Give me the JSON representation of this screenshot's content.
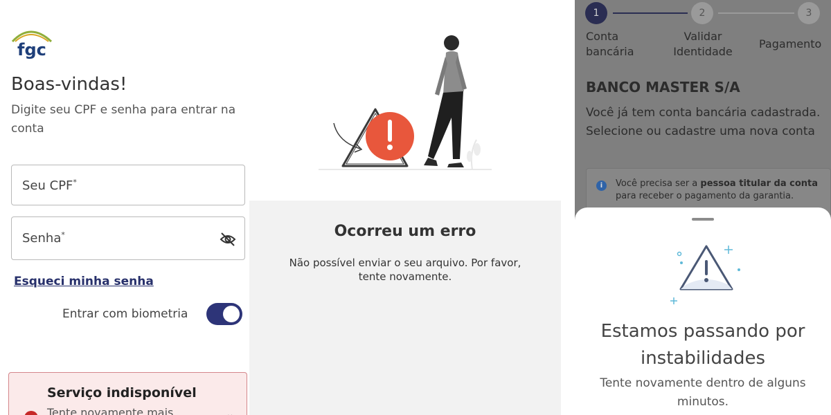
{
  "login": {
    "logo_text": "fgc",
    "welcome": "Boas-vindas!",
    "subtitle": "Digite seu CPF e senha para entrar na conta",
    "cpf_placeholder": "Seu CPF",
    "password_placeholder": "Senha",
    "required_mark": "*",
    "forgot_link": "Esqueci minha senha",
    "biometric_label": "Entrar com biometria",
    "biometric_enabled": true,
    "alert": {
      "title": "Serviço indisponível",
      "message": "Tente novamente mais"
    }
  },
  "error_screen": {
    "title": "Ocorreu um erro",
    "message": "Não possível enviar o seu arquivo. Por favor, tente novamente."
  },
  "payment_flow": {
    "steps": [
      {
        "number": "1",
        "label": "Conta bancária",
        "active": true
      },
      {
        "number": "2",
        "label": "Validar Identidade",
        "active": false
      },
      {
        "number": "3",
        "label": "Pagamento",
        "active": false
      }
    ],
    "bank_name": "BANCO MASTER S/A",
    "description": "Você já tem conta bancária cadastrada. Selecione ou cadastre uma nova conta",
    "info": {
      "icon": "info-icon",
      "prefix": "Você precisa ser a ",
      "bold": "pessoa titular da conta",
      "suffix": " para receber o pagamento da garantia."
    },
    "modal": {
      "title": "Estamos passando por instabilidades",
      "message": "Tente novamente dentro de alguns minutos."
    }
  },
  "colors": {
    "brand_navy": "#2d3478",
    "alert_bg": "#fbeaea",
    "alert_border": "#d4868b",
    "error_orange": "#e8573c",
    "overlay_gray": "#7f7f7f"
  }
}
